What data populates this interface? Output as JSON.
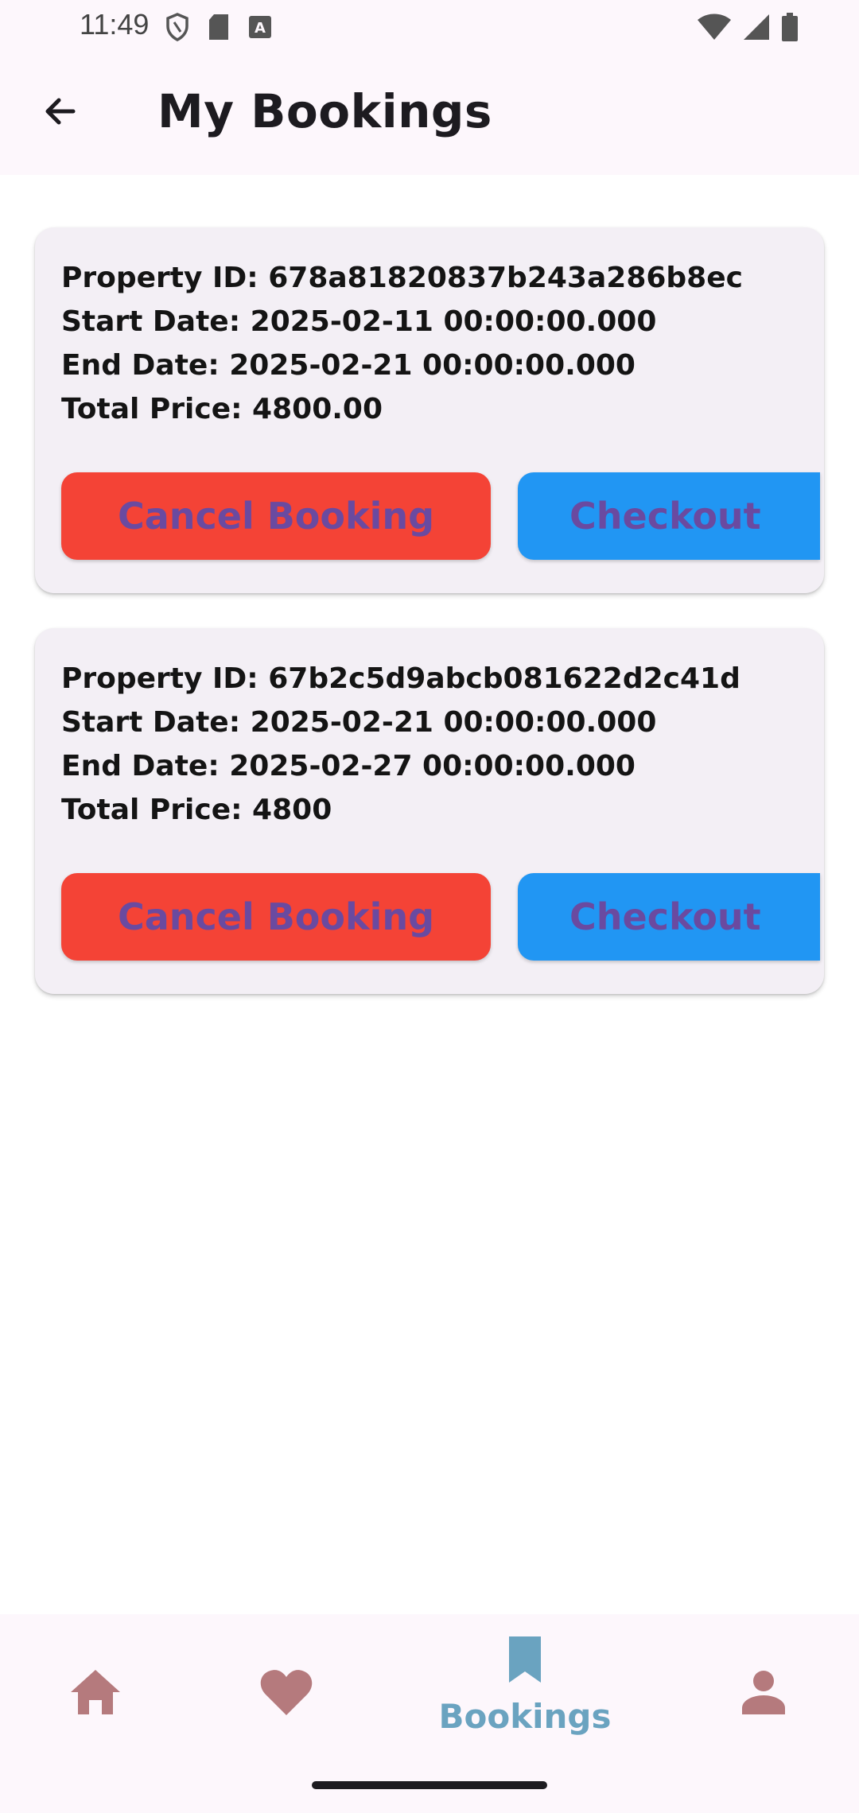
{
  "status_bar": {
    "time": "11:49",
    "left_icons": [
      "shield-icon",
      "sd-card-icon",
      "keyboard-a-icon"
    ],
    "right_icons": [
      "wifi-icon",
      "cell-signal-icon",
      "battery-icon"
    ]
  },
  "app_bar": {
    "back_icon": "arrow-back-icon",
    "title": "My Bookings"
  },
  "bookings": [
    {
      "property_line": "Property ID: 678a81820837b243a286b8ec",
      "start_line": "Start Date: 2025-02-11 00:00:00.000",
      "end_line": "End Date: 2025-02-21 00:00:00.000",
      "price_line": "Total Price: 4800.00",
      "cancel_label": "Cancel Booking",
      "checkout_label": "Checkout"
    },
    {
      "property_line": "Property ID: 67b2c5d9abcb081622d2c41d",
      "start_line": "Start Date: 2025-02-21 00:00:00.000",
      "end_line": "End Date: 2025-02-27 00:00:00.000",
      "price_line": "Total Price: 4800",
      "cancel_label": "Cancel Booking",
      "checkout_label": "Checkout"
    }
  ],
  "bottom_nav": {
    "items": [
      {
        "icon": "home-icon",
        "label": "",
        "active": false
      },
      {
        "icon": "heart-icon",
        "label": "",
        "active": false
      },
      {
        "icon": "bookmark-icon",
        "label": "Bookings",
        "active": true
      },
      {
        "icon": "person-icon",
        "label": "",
        "active": false
      }
    ]
  },
  "colors": {
    "cancel_bg": "#f44336",
    "checkout_bg": "#2196f3",
    "button_text": "#6a4aa0",
    "nav_inactive": "#b57a7d",
    "nav_active": "#6aa3c0",
    "card_bg": "#f3eff5",
    "bar_bg": "#fdf7fc"
  }
}
